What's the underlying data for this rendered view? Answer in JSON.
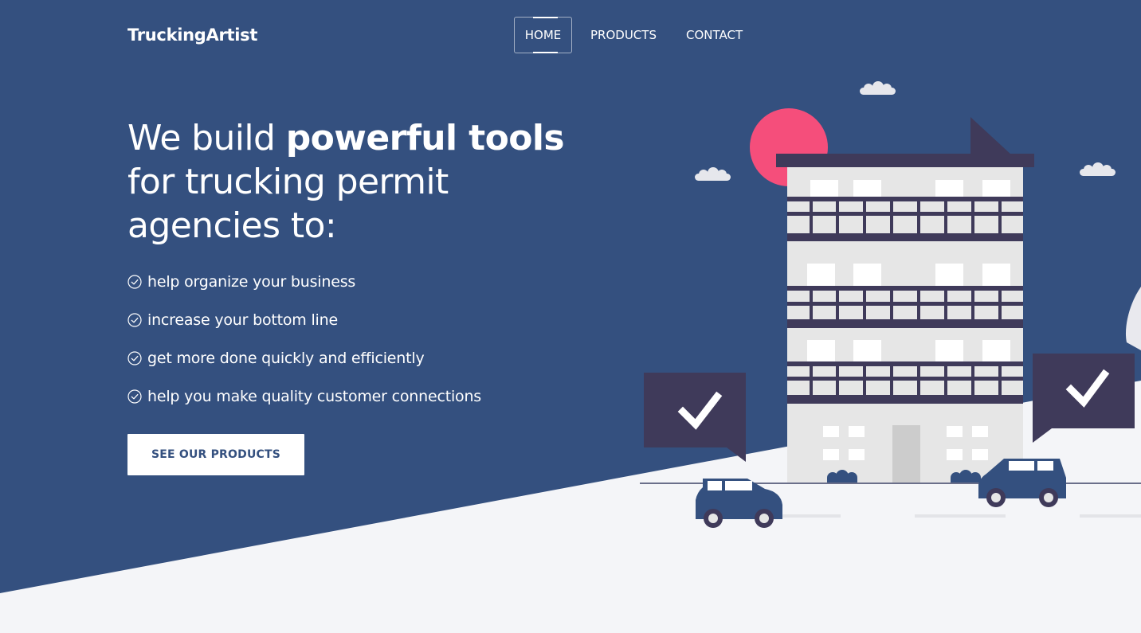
{
  "brand": {
    "name": "TruckingArtist"
  },
  "nav": {
    "items": [
      {
        "label": "HOME",
        "active": true
      },
      {
        "label": "PRODUCTS",
        "active": false
      },
      {
        "label": "CONTACT",
        "active": false
      }
    ]
  },
  "hero": {
    "headline_part1": "We build ",
    "headline_bold": "powerful tools",
    "headline_part2": " for trucking permit agencies to:",
    "benefits": [
      "help organize your business",
      "increase your bottom line",
      "get more done quickly and efficiently",
      "help you make quality customer connections"
    ],
    "cta_label": "SEE OUR PRODUCTS"
  },
  "icons": {
    "benefit_icon": "check-circle-icon"
  },
  "colors": {
    "hero_blue": "#34507f",
    "page_bg": "#f4f5f8",
    "building_dark": "#3f3a5a",
    "sun_pink": "#f54e7b",
    "white": "#ffffff"
  }
}
